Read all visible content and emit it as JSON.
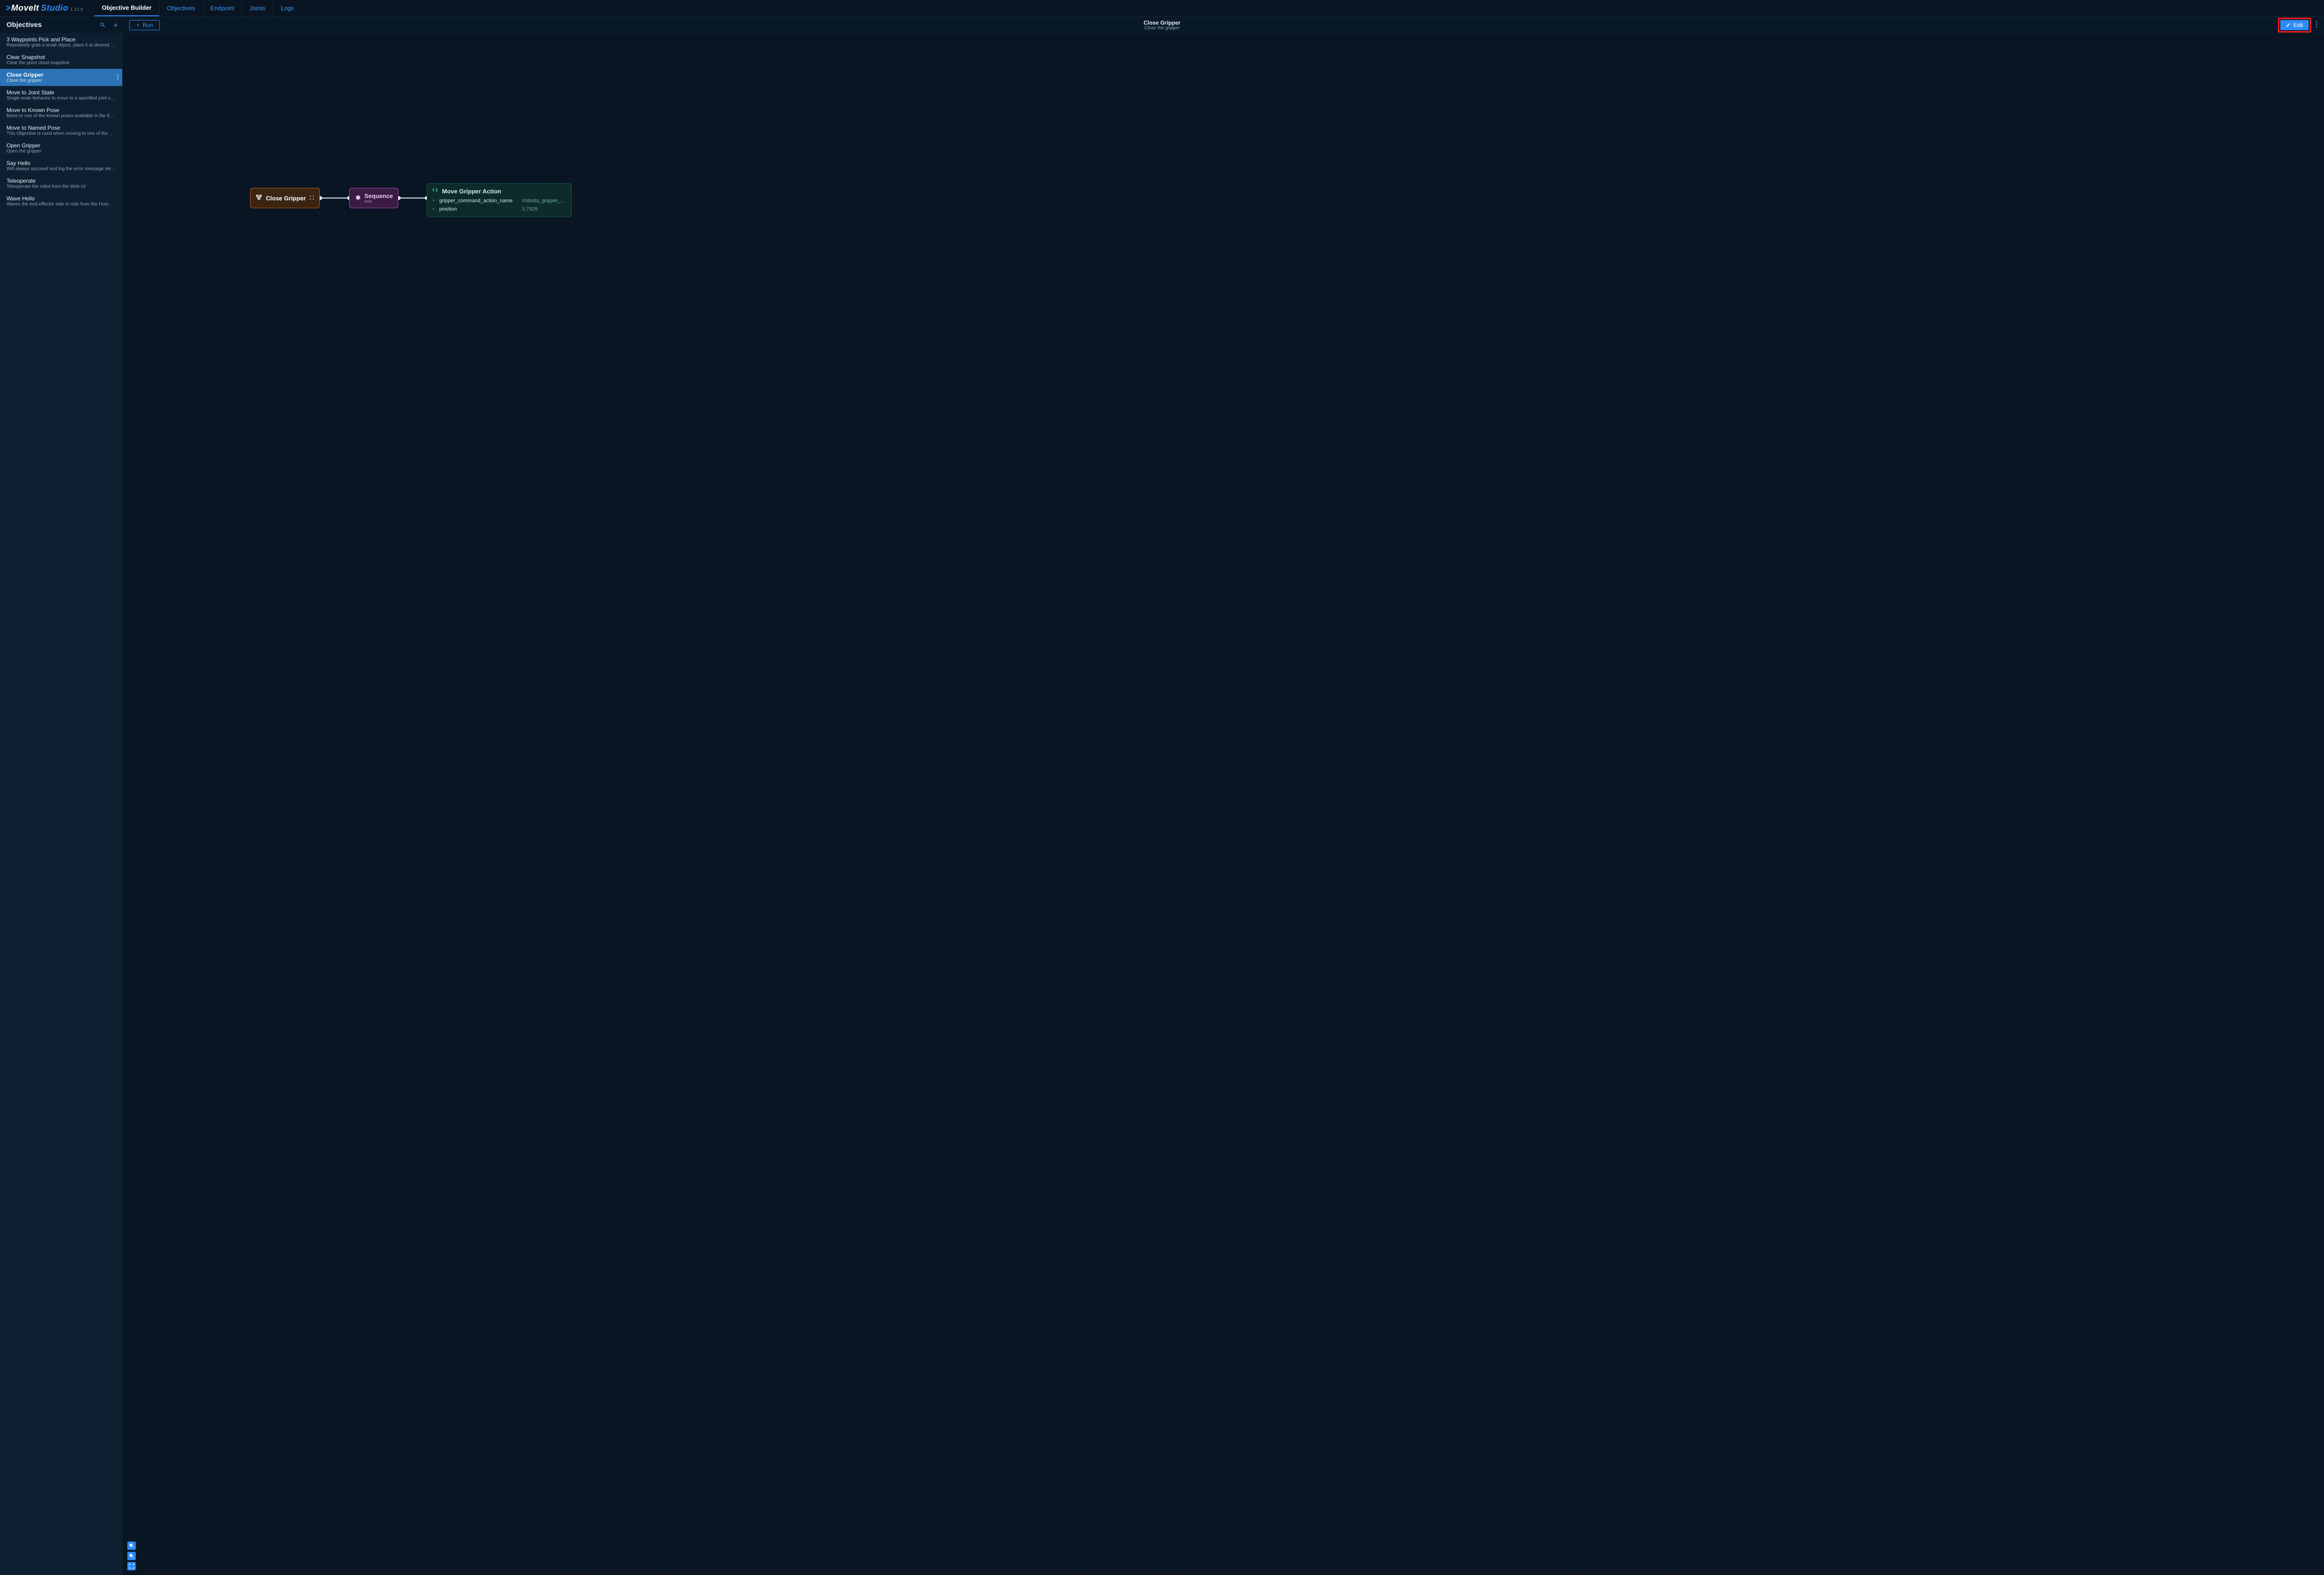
{
  "brand": {
    "caret": ">",
    "name1": "MoveIt",
    "name2": "Studio",
    "version": "1.12.0"
  },
  "nav": {
    "tabs": [
      {
        "label": "Objective Builder",
        "active": true
      },
      {
        "label": "Objectives"
      },
      {
        "label": "Endpoint"
      },
      {
        "label": "Joints"
      },
      {
        "label": "Logs"
      }
    ]
  },
  "toolbar": {
    "sidebar_title": "Objectives",
    "run_label": "Run",
    "center_title": "Close Gripper",
    "center_sub": "Close the gripper",
    "edit_label": "Edit"
  },
  "objectives": [
    {
      "title": "3 Waypoints Pick and Place",
      "desc": "Repeatedly grab a small object, place it at desired destinatio…"
    },
    {
      "title": "Clear Snapshot",
      "desc": "Clear the point cloud snapshot"
    },
    {
      "title": "Close Gripper",
      "desc": "Close the gripper",
      "selected": true
    },
    {
      "title": "Move to Joint State",
      "desc": "Single-node behavior to move to a specified joint state"
    },
    {
      "title": "Move to Known Pose",
      "desc": "Move to one of the known poses available in the Endpoint tab"
    },
    {
      "title": "Move to Named Pose",
      "desc": "This Objective is used when moving to one of the saved way…"
    },
    {
      "title": "Open Gripper",
      "desc": "Open the gripper"
    },
    {
      "title": "Say Hello",
      "desc": "Will always succeed and log the error message Hello Woold!"
    },
    {
      "title": "Teleoperate",
      "desc": "Teleoperate the robot from the Web UI"
    },
    {
      "title": "Wave Hello",
      "desc": "Waves the end-effector side to side from the Home waypoint"
    }
  ],
  "graph": {
    "close_gripper": {
      "label": "Close Gripper"
    },
    "sequence": {
      "label": "Sequence",
      "sub": "root"
    },
    "action": {
      "label": "Move Gripper Action",
      "params": [
        {
          "key": "gripper_command_action_name",
          "val": "/robotiq_gripper_controller/gr"
        },
        {
          "key": "position",
          "val": "0.7929"
        }
      ]
    }
  }
}
